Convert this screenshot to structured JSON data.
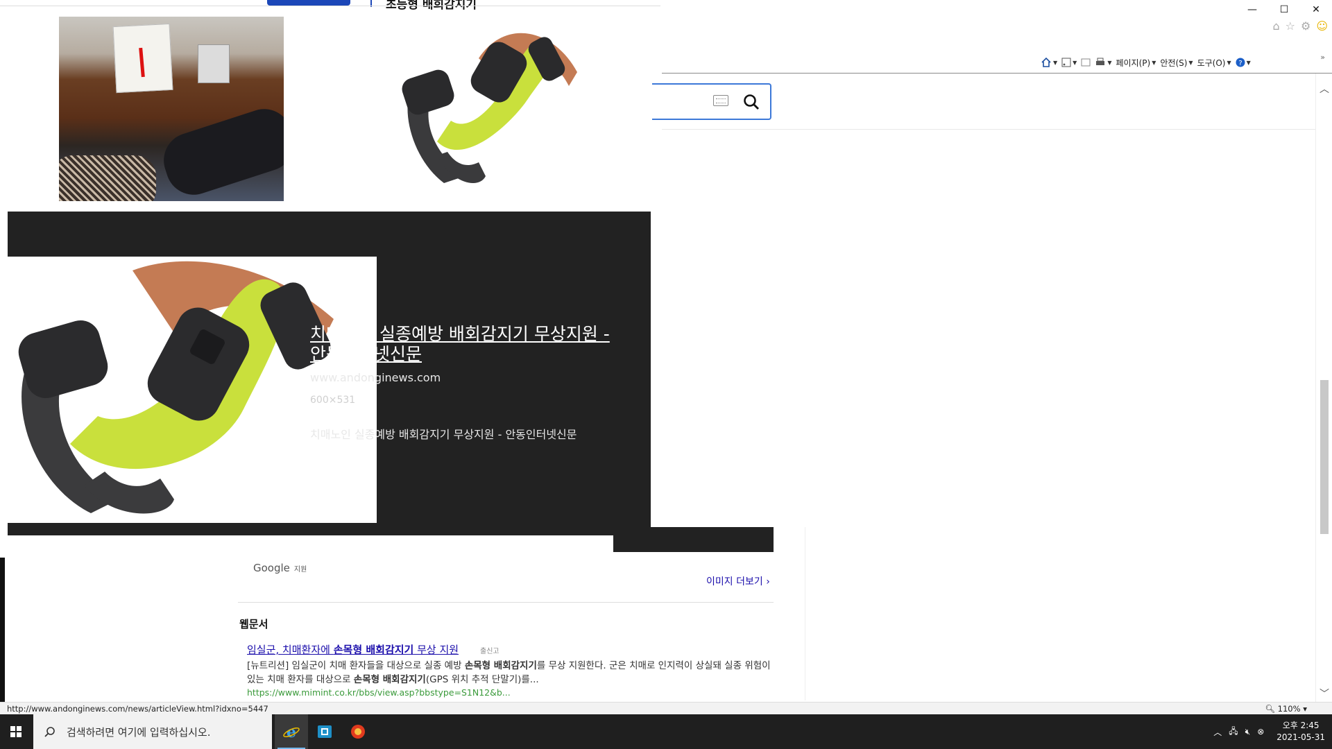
{
  "window": {
    "minimize": "—",
    "maximize": "☐",
    "close": "✕"
  },
  "command_bar": {
    "page": "페이지(P)",
    "safety": "안전(S)",
    "tools": "도구(O)"
  },
  "header": {
    "site_text": "초등형 배회감지기"
  },
  "preview": {
    "title": "치매노인 실종예방 배회감지기 무상지원 - 안동인터넷신문",
    "domain": "www.andonginews.com",
    "size": "600×531",
    "description": "치매노인 실종예방 배회감지기 무상지원 - 안동인터넷신문"
  },
  "google_label": "Google",
  "google_label_sub": "지원",
  "more_images": "이미지 더보기",
  "web_docs": {
    "heading": "웹문서",
    "result": {
      "title_pre": "임실군, 치매환자에 ",
      "title_bold": "손목형 배회감지기",
      "title_post": " 무상 지원",
      "flag": "출신고",
      "snippet_1": "[뉴트리션] 임실군이 치매 환자들을 대상으로 실종 예방 ",
      "snippet_b1": "손목형 배회감지기",
      "snippet_2": "를 무상 지원한다. 군은 치매로 인지력이 상실돼 실종 위험이 있는 치매 환자를 대상으로 ",
      "snippet_b2": "손목형 배회감지기",
      "snippet_3": "(GPS 위치 추적 단말기)를...",
      "url": "https://www.mimint.co.kr/bbs/view.asp?bbstype=S1N12&b..."
    }
  },
  "status": {
    "url": "http://www.andonginews.com/news/articleView.html?idxno=5447",
    "zoom": "110%"
  },
  "taskbar": {
    "search_placeholder": "검색하려면 여기에 입력하십시오.",
    "time": "오후 2:45",
    "date": "2021-05-31"
  },
  "icons": [
    "home-icon",
    "star-icon",
    "gear-icon",
    "smiley-icon",
    "search-icon",
    "keyboard-icon",
    "windows-icon",
    "ie-icon",
    "store-icon"
  ]
}
